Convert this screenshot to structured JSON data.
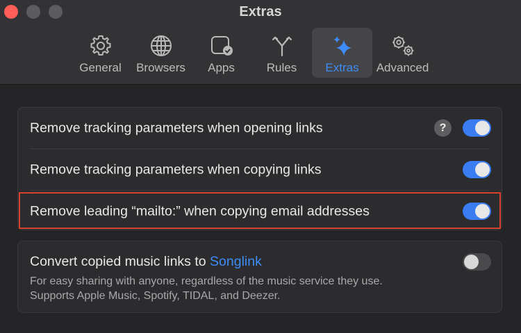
{
  "window": {
    "title": "Extras",
    "colors": {
      "accent": "#3d8cf7",
      "highlight_border": "#d8412c",
      "close": "#ff5f57"
    }
  },
  "toolbar": {
    "tabs": [
      {
        "label": "General",
        "icon": "gear-icon",
        "active": false
      },
      {
        "label": "Browsers",
        "icon": "globe-icon",
        "active": false
      },
      {
        "label": "Apps",
        "icon": "app-window-check-icon",
        "active": false
      },
      {
        "label": "Rules",
        "icon": "fork-icon",
        "active": false
      },
      {
        "label": "Extras",
        "icon": "sparkles-icon",
        "active": true
      },
      {
        "label": "Advanced",
        "icon": "gears-icon",
        "active": false
      }
    ]
  },
  "settings": {
    "rows": [
      {
        "label": "Remove tracking parameters when opening links",
        "enabled": true,
        "has_help": true,
        "help_symbol": "?"
      },
      {
        "label": "Remove tracking parameters when copying links",
        "enabled": true
      },
      {
        "label": "Remove leading “mailto:” when copying email addresses",
        "enabled": true,
        "highlighted": true
      }
    ],
    "music": {
      "label_prefix": "Convert copied music links to ",
      "link_text": "Songlink",
      "enabled": false,
      "description_line1": "For easy sharing with anyone, regardless of the music service they use.",
      "description_line2": "Supports Apple Music, Spotify, TIDAL, and Deezer."
    }
  }
}
